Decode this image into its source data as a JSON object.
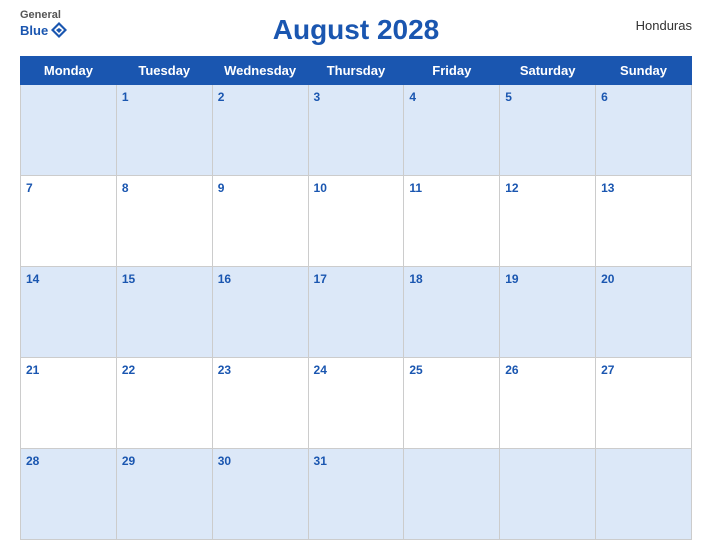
{
  "header": {
    "logo": {
      "general": "General",
      "blue": "Blue"
    },
    "title": "August 2028",
    "country": "Honduras"
  },
  "days": [
    "Monday",
    "Tuesday",
    "Wednesday",
    "Thursday",
    "Friday",
    "Saturday",
    "Sunday"
  ],
  "weeks": [
    [
      null,
      1,
      2,
      3,
      4,
      5,
      6
    ],
    [
      7,
      8,
      9,
      10,
      11,
      12,
      13
    ],
    [
      14,
      15,
      16,
      17,
      18,
      19,
      20
    ],
    [
      21,
      22,
      23,
      24,
      25,
      26,
      27
    ],
    [
      28,
      29,
      30,
      31,
      null,
      null,
      null
    ]
  ]
}
